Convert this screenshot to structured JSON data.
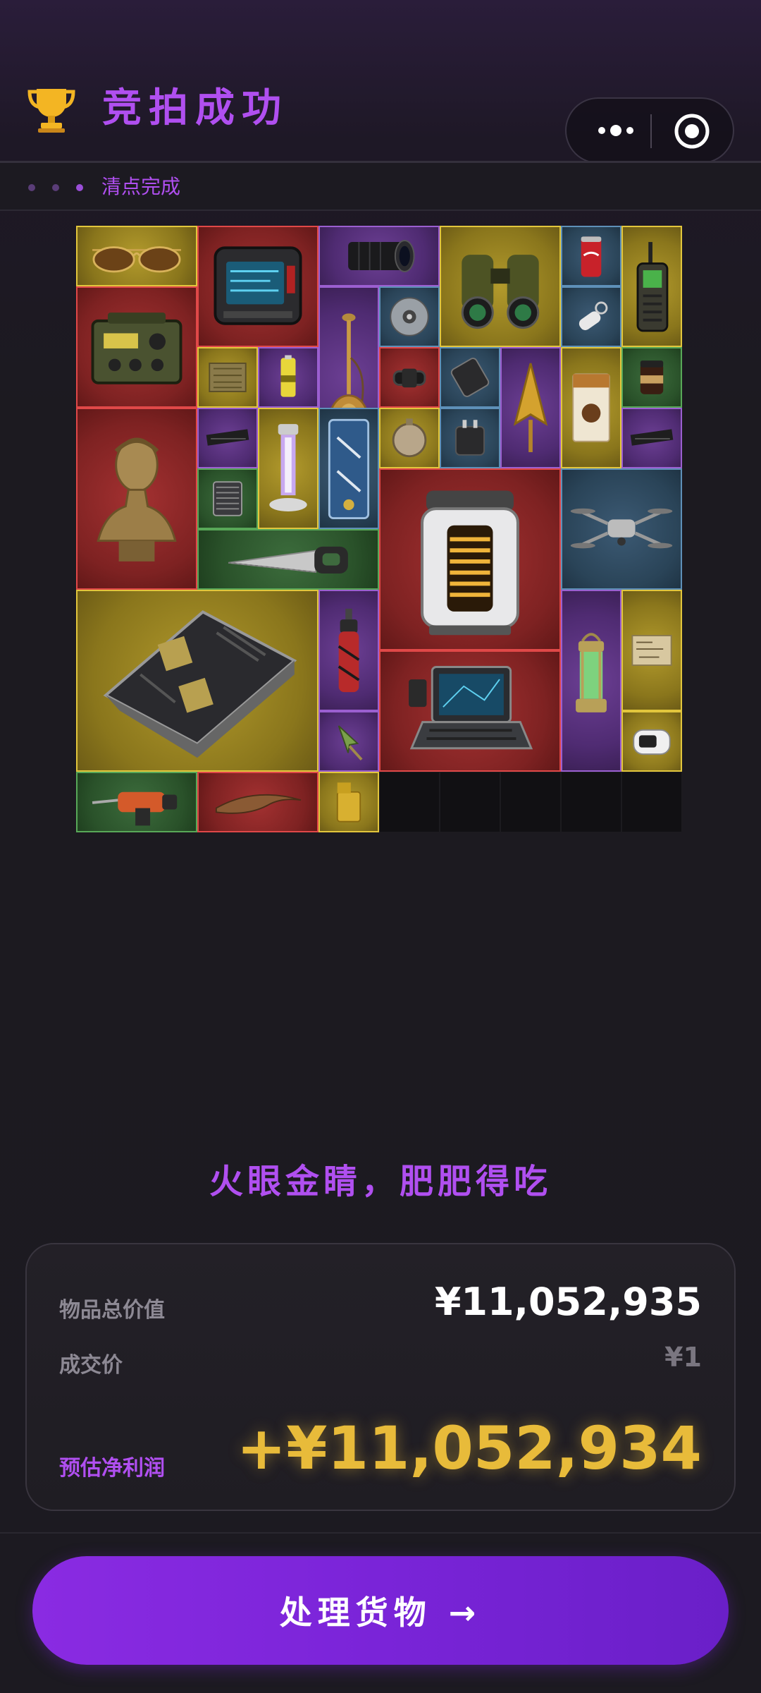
{
  "header": {
    "title": "竞拍成功",
    "trophy_icon": "trophy-icon",
    "menu_icon": "more-dots-icon",
    "close_icon": "target-close-icon"
  },
  "status": {
    "text": "清点完成"
  },
  "colors": {
    "accent": "#b04ff0",
    "gold": "#e8bb3a",
    "rarity": {
      "gold": "#e2c63c",
      "red": "#e04848",
      "purple": "#9b5fd0",
      "blue": "#5e90b8",
      "green": "#58a858"
    }
  },
  "inventory": {
    "items": [
      {
        "name": "sunglasses",
        "rarity": "gold"
      },
      {
        "name": "field-radio-monitor",
        "rarity": "red"
      },
      {
        "name": "camera-lens",
        "rarity": "purple"
      },
      {
        "name": "binoculars",
        "rarity": "gold"
      },
      {
        "name": "soda-can",
        "rarity": "blue"
      },
      {
        "name": "walkie-talkie",
        "rarity": "gold"
      },
      {
        "name": "military-radio",
        "rarity": "red"
      },
      {
        "name": "hookah",
        "rarity": "purple"
      },
      {
        "name": "data-disc",
        "rarity": "blue"
      },
      {
        "name": "usb-drive",
        "rarity": "blue"
      },
      {
        "name": "circuit-board",
        "rarity": "gold"
      },
      {
        "name": "battery",
        "rarity": "purple"
      },
      {
        "name": "smartwatch",
        "rarity": "red"
      },
      {
        "name": "phone",
        "rarity": "blue"
      },
      {
        "name": "golden-arrowhead",
        "rarity": "purple"
      },
      {
        "name": "coffee-box",
        "rarity": "gold"
      },
      {
        "name": "coffee-jar",
        "rarity": "green"
      },
      {
        "name": "marble-bust",
        "rarity": "red"
      },
      {
        "name": "memory-stick",
        "rarity": "purple"
      },
      {
        "name": "uv-lamp",
        "rarity": "gold"
      },
      {
        "name": "tool-case",
        "rarity": "blue"
      },
      {
        "name": "pocket-watch",
        "rarity": "gold"
      },
      {
        "name": "power-adapter",
        "rarity": "blue"
      },
      {
        "name": "memory-stick-2",
        "rarity": "purple"
      },
      {
        "name": "cpu-cooler",
        "rarity": "green"
      },
      {
        "name": "hand-saw",
        "rarity": "green"
      },
      {
        "name": "reactor-core",
        "rarity": "red"
      },
      {
        "name": "drone",
        "rarity": "blue"
      },
      {
        "name": "server-motherboard",
        "rarity": "gold"
      },
      {
        "name": "gas-torch",
        "rarity": "purple"
      },
      {
        "name": "spear-tip",
        "rarity": "purple"
      },
      {
        "name": "rugged-laptop",
        "rarity": "red"
      },
      {
        "name": "lantern",
        "rarity": "purple"
      },
      {
        "name": "old-map",
        "rarity": "gold"
      },
      {
        "name": "pulse-oximeter",
        "rarity": "gold"
      },
      {
        "name": "power-drill",
        "rarity": "green"
      },
      {
        "name": "fossil-claw",
        "rarity": "red"
      },
      {
        "name": "lighter",
        "rarity": "gold"
      }
    ],
    "empty_slots": 5
  },
  "slogan": "火眼金睛，肥肥得吃",
  "summary": {
    "total_label": "物品总价值",
    "total_value": "¥11,052,935",
    "deal_label": "成交价",
    "deal_value": "¥1",
    "profit_label": "预估净利润",
    "profit_value": "+¥11,052,934"
  },
  "action": {
    "label": "处理货物 →"
  }
}
